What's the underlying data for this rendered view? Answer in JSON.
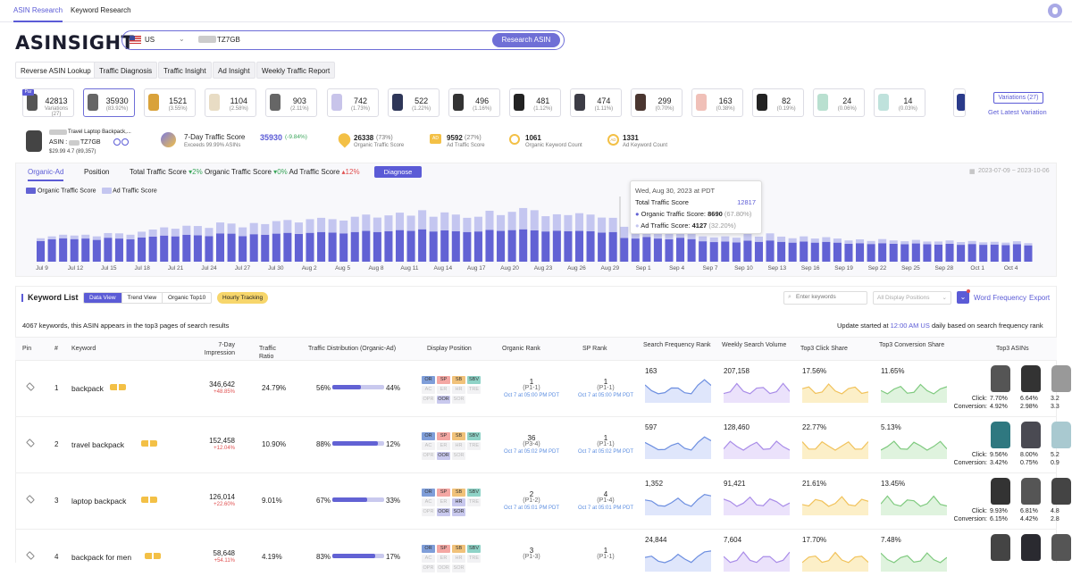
{
  "top_tabs": [
    {
      "label": "ASIN Research"
    },
    {
      "label": "Keyword Research"
    }
  ],
  "logo": "ASINSIGHT",
  "search": {
    "country": "US",
    "asin": "TZ7GB",
    "button": "Research ASIN"
  },
  "sub_tabs": [
    "Reverse ASIN Lookup",
    "Traffic Diagnosis",
    "Traffic Insight",
    "Ad Insight",
    "Weekly Traffic Report"
  ],
  "parent_badge": "Par",
  "variations": [
    {
      "n": "42813",
      "p": "Variations (27)",
      "c": "#555"
    },
    {
      "n": "35930",
      "p": "(83.92%)",
      "c": "#666"
    },
    {
      "n": "1521",
      "p": "(3.55%)",
      "c": "#d9a23a"
    },
    {
      "n": "1104",
      "p": "(2.58%)",
      "c": "#e8dcc4"
    },
    {
      "n": "903",
      "p": "(2.11%)",
      "c": "#666"
    },
    {
      "n": "742",
      "p": "(1.73%)",
      "c": "#c8c4ea"
    },
    {
      "n": "522",
      "p": "(1.22%)",
      "c": "#2e3658"
    },
    {
      "n": "496",
      "p": "(1.16%)",
      "c": "#333"
    },
    {
      "n": "481",
      "p": "(1.12%)",
      "c": "#222"
    },
    {
      "n": "474",
      "p": "(1.11%)",
      "c": "#3c3c46"
    },
    {
      "n": "299",
      "p": "(0.70%)",
      "c": "#4a3630"
    },
    {
      "n": "163",
      "p": "(0.38%)",
      "c": "#f0c0b8"
    },
    {
      "n": "82",
      "p": "(0.19%)",
      "c": "#222"
    },
    {
      "n": "24",
      "p": "(0.06%)",
      "c": "#b9e0d0"
    },
    {
      "n": "14",
      "p": "(0.03%)",
      "c": "#bfe2dc"
    }
  ],
  "variations_btn": "Variations (27)",
  "latest_variation": "Get Latest Variation",
  "product": {
    "title": "Travel Laptop Backpack,...",
    "asin_label": "ASIN :",
    "asin": "TZ7GB",
    "price": "$29.99 4.7 (89,357)"
  },
  "traffic_score": {
    "label": "7-Day Traffic Score",
    "value": "35930",
    "change": "(-9.84%)",
    "sub": "Exceeds 99.99% ASINs"
  },
  "organic_score": {
    "value": "26338",
    "pct": "(73%)",
    "label": "Organic Traffic Score"
  },
  "ad_score": {
    "value": "9592",
    "pct": "(27%)",
    "label": "Ad Traffic Score"
  },
  "organic_kw": {
    "value": "1061",
    "label": "Organic Keyword Count"
  },
  "ad_kw": {
    "value": "1331",
    "label": "Ad Keyword Count"
  },
  "chart_tabs": [
    "Organic-Ad",
    "Position"
  ],
  "total_score": {
    "l1": "Total Traffic Score",
    "v1": "2%",
    "l2": "Organic Traffic Score",
    "v2": "0%",
    "l3": "Ad Traffic Score",
    "v3": "12%"
  },
  "diagnose": "Diagnose",
  "date_range": "2023-07-09 ~ 2023-10-06",
  "chart_data": {
    "type": "bar",
    "stacked": true,
    "x_ticks": [
      "Jul 9",
      "Jul 12",
      "Jul 15",
      "Jul 18",
      "Jul 21",
      "Jul 24",
      "Jul 27",
      "Jul 30",
      "Aug 2",
      "Aug 5",
      "Aug 8",
      "Aug 11",
      "Aug 14",
      "Aug 17",
      "Aug 20",
      "Aug 23",
      "Aug 26",
      "Aug 29",
      "Sep 1",
      "Sep 4",
      "Sep 7",
      "Sep 10",
      "Sep 13",
      "Sep 16",
      "Sep 19",
      "Sep 22",
      "Sep 25",
      "Sep 28",
      "Oct 1",
      "Oct 4"
    ],
    "series": [
      {
        "name": "Organic Traffic Score",
        "color": "#6262d4",
        "values": [
          7600,
          8200,
          8600,
          8300,
          8500,
          8000,
          8800,
          8500,
          8200,
          8900,
          9200,
          9600,
          9300,
          9900,
          9700,
          9400,
          10400,
          10300,
          9400,
          10100,
          9900,
          10300,
          10600,
          10200,
          10600,
          10900,
          10700,
          10400,
          10900,
          11300,
          10900,
          11200,
          11600,
          11300,
          11900,
          11100,
          11500,
          11200,
          10900,
          11100,
          11700,
          11300,
          11600,
          11900,
          11500,
          11100,
          11400,
          11200,
          11300,
          11200,
          10700,
          10900,
          8690,
          8500,
          9100,
          8500,
          8200,
          8800,
          8300,
          7500,
          7200,
          7400,
          7100,
          7700,
          7300,
          7800,
          7300,
          7000,
          7400,
          7000,
          7300,
          7000,
          6600,
          6800,
          6500,
          6800,
          6600,
          6400,
          6700,
          6400,
          6300,
          6600,
          6200,
          6500,
          6200,
          6300,
          6100,
          6400,
          6000
        ]
      },
      {
        "name": "Ad Traffic Score",
        "color": "#c4c6f0",
        "values": [
          1000,
          1100,
          1300,
          1300,
          1400,
          1300,
          1700,
          1900,
          1700,
          2100,
          2600,
          3000,
          2800,
          3300,
          3400,
          3000,
          4000,
          3700,
          3200,
          4100,
          3900,
          4600,
          4700,
          4200,
          5000,
          5200,
          4900,
          4700,
          5600,
          6000,
          5300,
          5800,
          6400,
          5600,
          7000,
          5400,
          6600,
          6100,
          5200,
          5400,
          7000,
          5800,
          6700,
          7800,
          7400,
          5600,
          6000,
          5900,
          6500,
          6100,
          5500,
          5200,
          4127,
          3600,
          4300,
          4000,
          3500,
          4100,
          3200,
          1800,
          1700,
          1900,
          1700,
          2500,
          1900,
          2600,
          1900,
          1600,
          1900,
          1500,
          1700,
          1500,
          1200,
          1400,
          1100,
          1500,
          1200,
          1100,
          1300,
          1000,
          1100,
          1200,
          1000,
          1100,
          900,
          1000,
          900,
          1100,
          800
        ]
      }
    ],
    "tooltip": {
      "date": "Wed, Aug 30, 2023 at PDT",
      "total_label": "Total Traffic Score",
      "total": "12817",
      "organic_label": "Organic Traffic Score:",
      "organic": "8690",
      "organic_pct": "(67.80%)",
      "ad_label": "Ad Traffic Score:",
      "ad": "4127",
      "ad_pct": "(32.20%)"
    }
  },
  "keyword_list": {
    "title": "Keyword List",
    "views": [
      "Data View",
      "Trend View",
      "Organic Top10"
    ],
    "hourly": "Hourly Tracking",
    "search_ph": "Enter keywords",
    "display_pos": "All Display Positions",
    "word_freq": "Word Frequency",
    "export": "Export",
    "summary": "4067 keywords, this ASIN appears in the top3 pages of search results",
    "update_pre": "Update started at",
    "update_time": "12:00 AM US",
    "update_post": "daily based on search frequency rank"
  },
  "headers": [
    "Pin",
    "#",
    "Keyword",
    "7-Day Impression",
    "Traffic Ratio",
    "Traffic Distribution (Organic-Ad)",
    "Display Position",
    "Organic Rank",
    "SP Rank",
    "Search Frequency Rank",
    "Weekly Search Volume",
    "Top3 Click Share",
    "Top3 Conversion Share",
    "Top3 ASINs"
  ],
  "pos_labels": [
    "OR",
    "SP",
    "SB",
    "SBV",
    "AC",
    "ER",
    "HR",
    "TRE",
    "OPR",
    "OOR",
    "SOR"
  ],
  "rows": [
    {
      "n": "1",
      "kw": "backpack",
      "imp": "346,642",
      "imp_ch": "+48.85%",
      "ratio": "24.79%",
      "org": "56%",
      "ad": "44%",
      "ofrac": 0.56,
      "orank": "1",
      "orank_sub": "(P1-1)",
      "orank_date": "Oct 7 at 05:00 PM PDT",
      "sprank": "1",
      "sprank_sub": "(P1-1)",
      "sprank_date": "Oct 7 at 05:00 PM PDT",
      "sfr": "163",
      "wsv": "207,158",
      "click": "17.56%",
      "conv": "11.65%",
      "c1": "7.70%",
      "c2": "6.64%",
      "c3": "3.2",
      "v1": "4.92%",
      "v2": "2.98%",
      "v3": "3.3",
      "act": [
        1,
        1,
        1,
        1,
        0,
        0,
        0,
        0,
        0,
        1,
        0
      ]
    },
    {
      "n": "2",
      "kw": "travel backpack",
      "imp": "152,458",
      "imp_ch": "+12.04%",
      "ratio": "10.90%",
      "org": "88%",
      "ad": "12%",
      "ofrac": 0.88,
      "orank": "36",
      "orank_sub": "(P3-4)",
      "orank_date": "Oct 7 at 05:02 PM PDT",
      "sprank": "1",
      "sprank_sub": "(P1-1)",
      "sprank_date": "Oct 7 at 05:02 PM PDT",
      "sfr": "597",
      "wsv": "128,460",
      "click": "22.77%",
      "conv": "5.13%",
      "c1": "9.56%",
      "c2": "8.00%",
      "c3": "5.2",
      "v1": "3.42%",
      "v2": "0.75%",
      "v3": "0.9",
      "act": [
        1,
        1,
        1,
        1,
        0,
        0,
        0,
        0,
        0,
        1,
        0
      ]
    },
    {
      "n": "3",
      "kw": "laptop backpack",
      "imp": "126,014",
      "imp_ch": "+22.60%",
      "ratio": "9.01%",
      "org": "67%",
      "ad": "33%",
      "ofrac": 0.67,
      "orank": "2",
      "orank_sub": "(P1-2)",
      "orank_date": "Oct 7 at 05:01 PM PDT",
      "sprank": "4",
      "sprank_sub": "(P1-4)",
      "sprank_date": "Oct 7 at 05:01 PM PDT",
      "sfr": "1,352",
      "wsv": "91,421",
      "click": "21.61%",
      "conv": "13.45%",
      "c1": "9.93%",
      "c2": "6.81%",
      "c3": "4.8",
      "v1": "6.15%",
      "v2": "4.42%",
      "v3": "2.8",
      "act": [
        1,
        1,
        1,
        1,
        0,
        0,
        1,
        0,
        0,
        1,
        1
      ]
    },
    {
      "n": "4",
      "kw": "backpack for men",
      "imp": "58,648",
      "imp_ch": "+54.11%",
      "ratio": "4.19%",
      "org": "83%",
      "ad": "17%",
      "ofrac": 0.83,
      "orank": "3",
      "orank_sub": "(P1-3)",
      "orank_date": "",
      "sprank": "1",
      "sprank_sub": "(P1-1)",
      "sprank_date": "",
      "sfr": "24,844",
      "wsv": "7,604",
      "click": "17.70%",
      "conv": "7.48%",
      "c1": "",
      "c2": "",
      "c3": "",
      "v1": "",
      "v2": "",
      "v3": "",
      "act": [
        1,
        1,
        1,
        1,
        0,
        0,
        0,
        0,
        0,
        0,
        0
      ]
    }
  ],
  "click_label": "Click:",
  "conv_label": "Conversion:"
}
